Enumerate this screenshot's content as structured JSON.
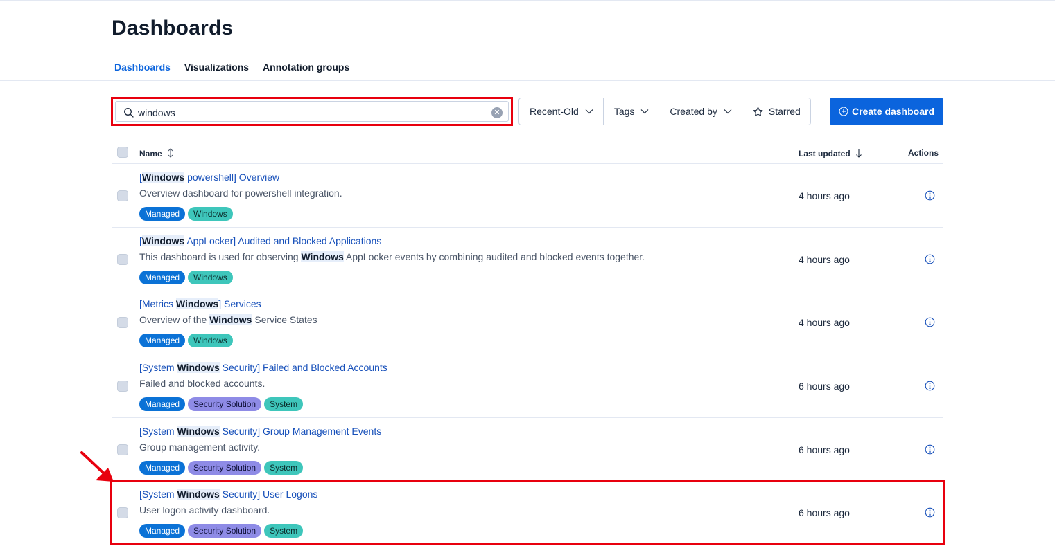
{
  "page": {
    "title": "Dashboards"
  },
  "tabs": [
    {
      "label": "Dashboards",
      "active": true
    },
    {
      "label": "Visualizations",
      "active": false
    },
    {
      "label": "Annotation groups",
      "active": false
    }
  ],
  "search": {
    "value": "windows",
    "placeholder": ""
  },
  "filters": {
    "sort": "Recent-Old",
    "tags": "Tags",
    "created_by": "Created by",
    "starred": "Starred"
  },
  "create_button": {
    "label": "Create dashboard"
  },
  "table": {
    "columns": {
      "name": "Name",
      "last_updated": "Last updated",
      "actions": "Actions"
    },
    "rows": [
      {
        "title_pre": "[",
        "title_hl": "Windows",
        "title_post": " powershell] Overview",
        "desc_pre": "Overview dashboard for powershell integration.",
        "desc_hl": "",
        "desc_post": "",
        "badges": [
          "Managed",
          "Windows"
        ],
        "updated": "4 hours ago"
      },
      {
        "title_pre": "[",
        "title_hl": "Windows",
        "title_post": " AppLocker] Audited and Blocked Applications",
        "desc_pre": "This dashboard is used for observing ",
        "desc_hl": "Windows",
        "desc_post": " AppLocker events by combining audited and blocked events together.",
        "badges": [
          "Managed",
          "Windows"
        ],
        "updated": "4 hours ago"
      },
      {
        "title_pre": "[Metrics ",
        "title_hl": "Windows",
        "title_post": "] Services",
        "desc_pre": "Overview of the ",
        "desc_hl": "Windows",
        "desc_post": " Service States",
        "badges": [
          "Managed",
          "Windows"
        ],
        "updated": "4 hours ago"
      },
      {
        "title_pre": "[System ",
        "title_hl": "Windows",
        "title_post": " Security] Failed and Blocked Accounts",
        "desc_pre": "Failed and blocked accounts.",
        "desc_hl": "",
        "desc_post": "",
        "badges": [
          "Managed",
          "Security Solution",
          "System"
        ],
        "updated": "6 hours ago"
      },
      {
        "title_pre": "[System ",
        "title_hl": "Windows",
        "title_post": " Security] Group Management Events",
        "desc_pre": "Group management activity.",
        "desc_hl": "",
        "desc_post": "",
        "badges": [
          "Managed",
          "Security Solution",
          "System"
        ],
        "updated": "6 hours ago"
      },
      {
        "title_pre": "[System ",
        "title_hl": "Windows",
        "title_post": " Security] User Logons",
        "desc_pre": "User logon activity dashboard.",
        "desc_hl": "",
        "desc_post": "",
        "badges": [
          "Managed",
          "Security Solution",
          "System"
        ],
        "updated": "6 hours ago"
      }
    ]
  },
  "colors": {
    "accent": "#0b64dd",
    "link": "#1750ba",
    "annotation": "#e8000e",
    "managed": "#0b72d6",
    "windows": "#3ec6bb",
    "security": "#8e8be6"
  },
  "icons": {
    "search": "search-icon",
    "clear": "clear-icon",
    "chevron": "chevron-down-icon",
    "star": "star-icon",
    "plus": "plus-circle-icon",
    "info": "info-icon",
    "sort": "sort-icon"
  }
}
